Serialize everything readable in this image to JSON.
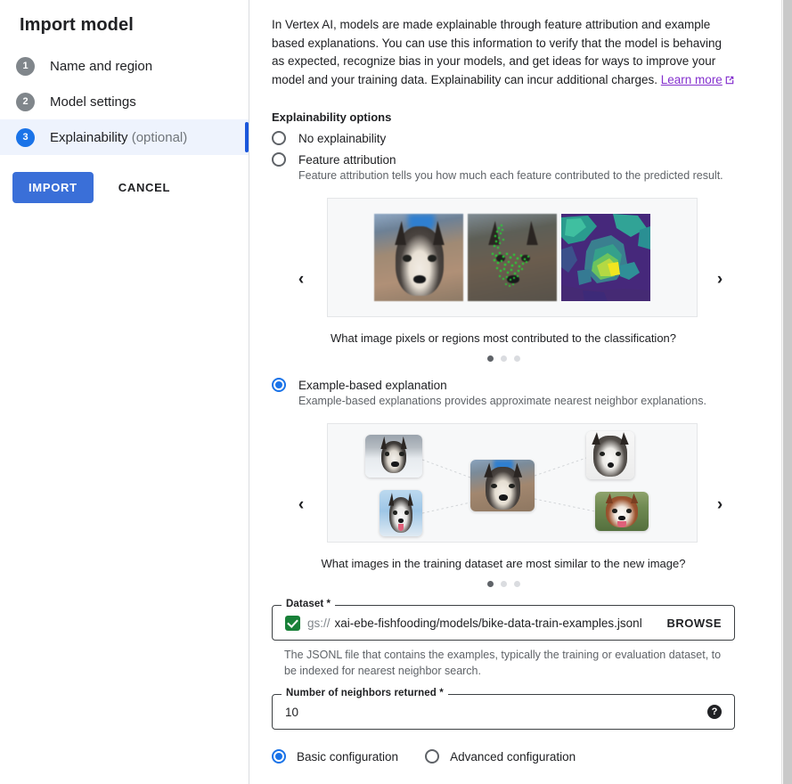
{
  "sidebar": {
    "title": "Import model",
    "steps": [
      {
        "num": "1",
        "label": "Name and region",
        "optional": "",
        "active": false
      },
      {
        "num": "2",
        "label": "Model settings",
        "optional": "",
        "active": false
      },
      {
        "num": "3",
        "label": "Explainability",
        "optional": "(optional)",
        "active": true
      }
    ],
    "import_label": "IMPORT",
    "cancel_label": "CANCEL"
  },
  "main": {
    "intro": "In Vertex AI, models are made explainable through feature attribution and example based explanations. You can use this information to verify that the model is behaving as expected, recognize bias in your models, and get ideas for ways to improve your model and your training data. Explainability can incur additional charges.",
    "learn_more": "Learn more",
    "options_title": "Explainability options",
    "options": [
      {
        "label": "No explainability",
        "desc": "",
        "checked": false
      },
      {
        "label": "Feature attribution",
        "desc": "Feature attribution tells you how much each feature contributed to the predicted result.",
        "checked": false
      },
      {
        "label": "Example-based explanation",
        "desc": "Example-based explanations provides approximate nearest neighbor explanations.",
        "checked": true
      }
    ],
    "carousel_feature": {
      "caption": "What image pixels or regions most contributed to the classification?",
      "prev": "‹",
      "next": "›",
      "dot_count": 3,
      "active_dot": 0
    },
    "carousel_example": {
      "caption": "What images in the training dataset are most similar to the new image?",
      "prev": "‹",
      "next": "›",
      "dot_count": 3,
      "active_dot": 0
    },
    "dataset_field": {
      "legend": "Dataset *",
      "prefix": "gs://",
      "value": "xai-ebe-fishfooding/models/bike-data-train-examples.jsonl",
      "browse_label": "BROWSE",
      "hint": "The JSONL file that contains the examples, typically the training or evaluation dataset, to be indexed for nearest neighbor search."
    },
    "neighbors_field": {
      "legend": "Number of neighbors returned *",
      "value": "10",
      "help_glyph": "?"
    },
    "config_options": [
      {
        "label": "Basic configuration",
        "checked": true
      },
      {
        "label": "Advanced configuration",
        "checked": false
      }
    ]
  },
  "colors": {
    "accent_blue": "#1a73e8",
    "button_blue": "#3a6fd8",
    "link_purple": "#8430ce",
    "check_green": "#188038",
    "step_grey": "#80868b"
  }
}
